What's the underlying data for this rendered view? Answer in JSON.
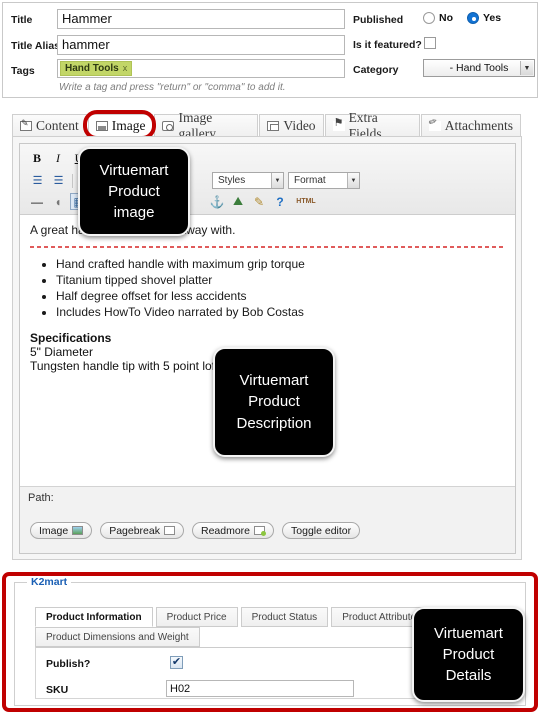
{
  "form": {
    "title_label": "Title",
    "title_value": "Hammer",
    "alias_label": "Title Alias",
    "alias_value": "hammer",
    "tags_label": "Tags",
    "tag_chip": "Hand Tools",
    "tag_remove": "x",
    "tags_hint": "Write a tag and press \"return\" or \"comma\" to add it.",
    "published_label": "Published",
    "published_no": "No",
    "published_yes": "Yes",
    "published_value": "Yes",
    "featured_label": "Is it featured?",
    "featured_checked": false,
    "category_label": "Category",
    "category_value": "- Hand Tools",
    "select_arrow": "▼"
  },
  "tabs": [
    {
      "label": "Content",
      "icon": "content-icon",
      "active": false
    },
    {
      "label": "Image",
      "icon": "image-icon",
      "active": true
    },
    {
      "label": "Image gallery",
      "icon": "gallery-icon",
      "active": false
    },
    {
      "label": "Video",
      "icon": "video-icon",
      "active": false
    },
    {
      "label": "Extra Fields",
      "icon": "extra-fields-icon",
      "active": false
    },
    {
      "label": "Attachments",
      "icon": "attachments-icon",
      "active": false
    }
  ],
  "editor": {
    "toolbar": {
      "bold": "B",
      "italic": "I",
      "underline": "U",
      "bullet_list": "☰",
      "numbered_list": "☰",
      "indent": "☷",
      "horizontal_rule": "—",
      "eraser": "◖",
      "table": "▦",
      "anchor": "⚓",
      "insert_image": "⛰",
      "cleanup": "✎",
      "help": "?",
      "html_source": "HTML",
      "styles_label": "Styles",
      "format_label": "Format"
    },
    "content": {
      "intro": "A great hammer to hammer away with.",
      "bullets": [
        "Hand crafted handle with maximum grip torque",
        "Titanium tipped shovel platter",
        "Half degree offset for less accidents",
        "Includes HowTo Video narrated by Bob Costas"
      ],
      "spec_heading": "Specifications",
      "spec_lines": [
        "5\" Diameter",
        "Tungsten handle tip with 5 point loft"
      ]
    },
    "path_label": "Path:",
    "buttons": [
      {
        "label": "Image",
        "icon": "image-insert-icon"
      },
      {
        "label": "Pagebreak",
        "icon": "pagebreak-icon"
      },
      {
        "label": "Readmore",
        "icon": "readmore-icon"
      },
      {
        "label": "Toggle editor",
        "icon": ""
      }
    ]
  },
  "k2mart": {
    "legend": "K2mart",
    "tabs_row1": [
      "Product Information",
      "Product Price",
      "Product Status",
      "Product Attributes"
    ],
    "tabs_row2": [
      "Product Dimensions and Weight"
    ],
    "active_tab": "Product Information",
    "publish_label": "Publish?",
    "publish_checked": true,
    "publish_mark": "✔",
    "sku_label": "SKU",
    "sku_value": "H02"
  },
  "callouts": [
    {
      "id": "image",
      "lines": [
        "Virtuemart",
        "Product",
        "image"
      ]
    },
    {
      "id": "description",
      "lines": [
        "Virtuemart",
        "Product",
        "Description"
      ]
    },
    {
      "id": "details",
      "lines": [
        "Virtuemart",
        "Product",
        "Details"
      ]
    }
  ],
  "colors": {
    "highlight": "#c00000",
    "tag_bg": "#c2d667",
    "legend": "#1a5fb4",
    "radio_on": "#1273d4"
  }
}
